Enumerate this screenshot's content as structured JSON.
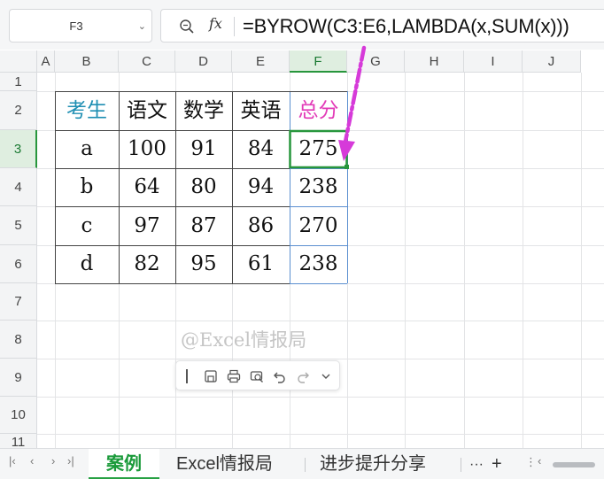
{
  "formula_bar": {
    "name_box": "F3",
    "fx_label": "fx",
    "formula": "=BYROW(C3:E6,LAMBDA(x,SUM(x)))"
  },
  "columns": [
    "A",
    "B",
    "C",
    "D",
    "E",
    "F",
    "G",
    "H",
    "I",
    "J"
  ],
  "rows": [
    "1",
    "2",
    "3",
    "4",
    "5",
    "6",
    "7",
    "8",
    "9",
    "10",
    "11"
  ],
  "selected_cell": "F3",
  "table": {
    "headers": [
      "考生",
      "语文",
      "数学",
      "英语",
      "总分"
    ],
    "data": [
      [
        "a",
        "100",
        "91",
        "84",
        "275"
      ],
      [
        "b",
        "64",
        "80",
        "94",
        "238"
      ],
      [
        "c",
        "97",
        "87",
        "86",
        "270"
      ],
      [
        "d",
        "82",
        "95",
        "61",
        "238"
      ]
    ]
  },
  "watermark": "@Excel情报局",
  "quick_toolbar": {
    "icons": [
      "save-icon",
      "print-icon",
      "print-preview-icon",
      "undo-icon",
      "redo-icon",
      "chevron-down-icon"
    ]
  },
  "sheet_tabs": [
    "案例",
    "Excel情报局",
    "进步提升分享"
  ],
  "active_tab": "案例",
  "tab_controls": {
    "more": "···",
    "add": "+"
  },
  "colors": {
    "header_blue": "#1f8fb3",
    "header_pink": "#e23bb8",
    "selection_green": "#27963c",
    "arrow_magenta": "#d63ad9",
    "active_tab_green": "#1a9a3a"
  }
}
